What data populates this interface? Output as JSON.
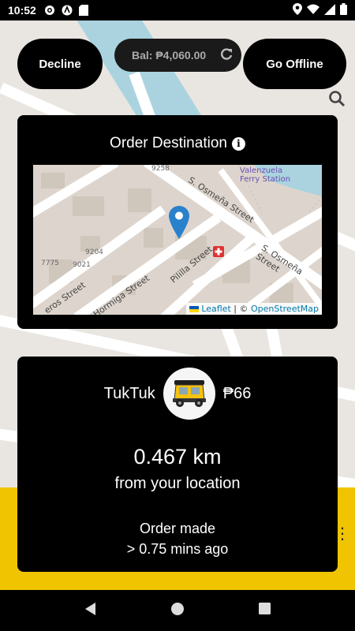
{
  "status_bar": {
    "time": "10:52",
    "left_icons": [
      "gear-icon",
      "app-icon",
      "sd-card-icon"
    ],
    "right_icons": [
      "location-icon",
      "wifi-icon",
      "signal-icon",
      "battery-icon"
    ]
  },
  "top_bar": {
    "decline_label": "Decline",
    "balance_label": "Bal: ₱4,060.00",
    "go_offline_label": "Go Offline"
  },
  "destination_card": {
    "title": "Order Destination",
    "map": {
      "streets": [
        "S. Osmeña Street",
        "S. Osmeña Street",
        "Pililla Street",
        "Hormiga Street",
        "eros Street"
      ],
      "place_label": "Valenzuela Ferry Station",
      "numbers": [
        "9258",
        "9204",
        "7775",
        "9021"
      ],
      "attribution_leaflet": "Leaflet",
      "attribution_separator": " | © ",
      "attribution_osm": "OpenStreetMap"
    }
  },
  "order_card": {
    "vehicle_type": "TukTuk",
    "fare": "₱66",
    "distance": "0.467 km",
    "distance_caption": "from your location",
    "order_made_label": "Order made",
    "order_made_time": "> 0.75 mins ago"
  },
  "colors": {
    "accent_yellow": "#f0c400",
    "marker_blue": "#2a81cb",
    "card_bg": "#000000"
  }
}
